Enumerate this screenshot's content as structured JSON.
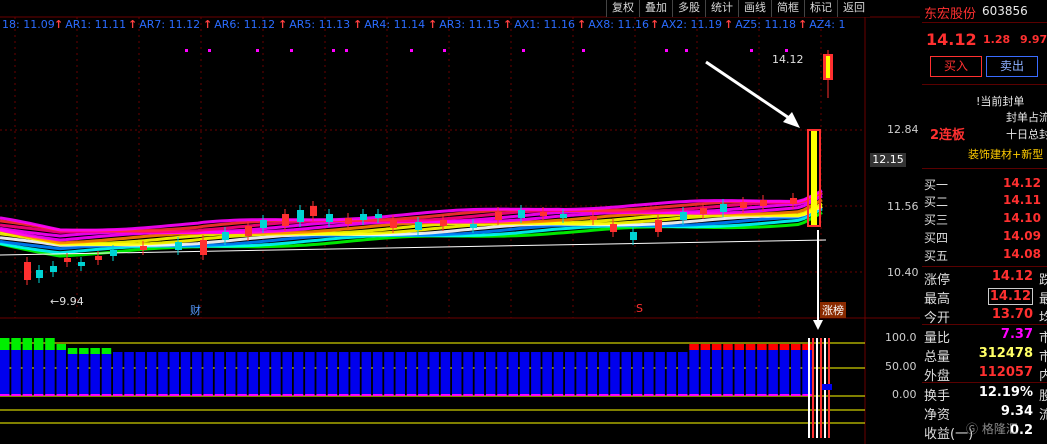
{
  "toolbar": {
    "items": [
      "复权",
      "叠加",
      "多股",
      "统计",
      "画线",
      "简框",
      "标记",
      "返回"
    ]
  },
  "ar_labels": [
    "18: 11.09",
    "AR1: 11.11",
    "AR7: 11.12",
    "AR6: 11.12",
    "AR5: 11.13",
    "AR4: 11.14",
    "AR3: 11.15",
    "AX1: 11.16",
    "AX8: 11.16",
    "AX2: 11.19",
    "AZ5: 11.18",
    "AZ4: 1"
  ],
  "chart": {
    "price_ticks": [
      "12.84",
      "11.56",
      "10.40"
    ],
    "current_price": "12.15",
    "high_marker": "14.12",
    "low_marker": "←9.94",
    "indicator_ticks": [
      "100.0",
      "50.00",
      "0.00"
    ],
    "event_labels": {
      "cai": "财",
      "s": "S",
      "zhangbang": "涨榜"
    },
    "colors": {
      "up": "#ff3030",
      "down": "#00d4d4",
      "blue_bar": "#0000ee",
      "green_bar": "#00ee00",
      "red_bar": "#ff0000",
      "grid": "#6a0000",
      "band_magenta": "#ff00ff",
      "band_yellow": "#ffff00"
    }
  },
  "panel": {
    "name": "东宏股份",
    "code": "603856",
    "price": "14.12",
    "change": "1.28",
    "change_pct": "9.97",
    "buy_label": "买入",
    "sell_label": "卖出",
    "note1": "!当前封单",
    "note2": "封单占流",
    "note3": "十日总封",
    "lianban": "2连板",
    "concept": "装饰建材+新型",
    "order_book": [
      {
        "label": "买一",
        "value": "14.12"
      },
      {
        "label": "买二",
        "value": "14.11"
      },
      {
        "label": "买三",
        "value": "14.10"
      },
      {
        "label": "买四",
        "value": "14.09"
      },
      {
        "label": "买五",
        "value": "14.08"
      }
    ],
    "stats_a": [
      {
        "label": "涨停",
        "value": "14.12",
        "suffix": "跌"
      },
      {
        "label": "最高",
        "value": "14.12",
        "suffix": "最"
      },
      {
        "label": "今开",
        "value": "13.70",
        "suffix": "均"
      }
    ],
    "stats_b": [
      {
        "label": "量比",
        "value": "7.37",
        "suffix": "市"
      },
      {
        "label": "总量",
        "value": "312478",
        "suffix": "市"
      },
      {
        "label": "外盘",
        "value": "112057",
        "suffix": "内"
      }
    ],
    "stats_c": [
      {
        "label": "换手",
        "value": "12.19%",
        "suffix": "股"
      },
      {
        "label": "净资",
        "value": "9.34",
        "suffix": "流"
      },
      {
        "label": "收益(一)",
        "value": "0.2",
        "suffix": ""
      }
    ]
  },
  "watermark": "格隆汇"
}
